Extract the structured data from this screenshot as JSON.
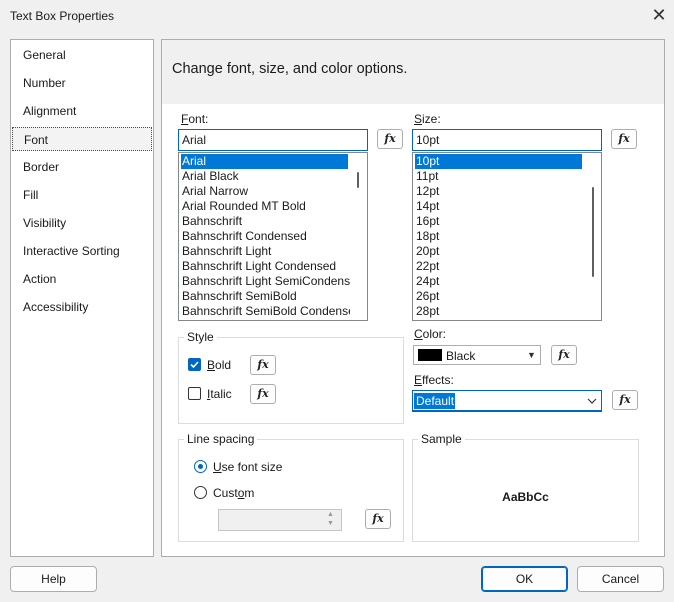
{
  "window": {
    "title": "Text Box Properties",
    "close_glyph": "✕"
  },
  "nav": {
    "items": [
      "General",
      "Number",
      "Alignment",
      "Font",
      "Border",
      "Fill",
      "Visibility",
      "Interactive Sorting",
      "Action",
      "Accessibility"
    ],
    "selected": "Font"
  },
  "header": {
    "text": "Change font, size, and color options."
  },
  "font": {
    "label_prefix": "F",
    "label_rest": "ont:",
    "value": "Arial",
    "list": [
      "Arial",
      "Arial Black",
      "Arial Narrow",
      "Arial Rounded MT Bold",
      "Bahnschrift",
      "Bahnschrift Condensed",
      "Bahnschrift Light",
      "Bahnschrift Light Condensed",
      "Bahnschrift Light SemiCondens",
      "Bahnschrift SemiBold",
      "Bahnschrift SemiBold Condense"
    ],
    "selected_index": 0
  },
  "size": {
    "label_prefix": "S",
    "label_rest": "ize:",
    "value": "10pt",
    "list": [
      "10pt",
      "11pt",
      "12pt",
      "14pt",
      "16pt",
      "18pt",
      "20pt",
      "22pt",
      "24pt",
      "26pt",
      "28pt"
    ],
    "selected_index": 0
  },
  "fx_label": "fx",
  "style": {
    "legend": "Style",
    "bold": {
      "prefix": "B",
      "rest": "old",
      "checked": true
    },
    "italic": {
      "prefix": "I",
      "rest": "talic",
      "checked": false
    }
  },
  "color": {
    "label_prefix": "C",
    "label_rest": "olor:",
    "value": "Black",
    "swatch": "#000000"
  },
  "effects": {
    "label_prefix": "E",
    "label_rest": "ffects:",
    "value": "Default"
  },
  "line_spacing": {
    "legend": "Line spacing",
    "use_font_size": {
      "prefix": "U",
      "rest": "se font size",
      "checked": true
    },
    "custom": {
      "prefix": "Cust",
      "ul": "o",
      "rest": "m",
      "checked": false
    },
    "custom_value": ""
  },
  "sample": {
    "legend": "Sample",
    "text": "AaBbCc"
  },
  "buttons": {
    "help": "Help",
    "ok": "OK",
    "cancel": "Cancel"
  },
  "colors": {
    "accent": "#0067c0",
    "selection": "#0078d7"
  }
}
